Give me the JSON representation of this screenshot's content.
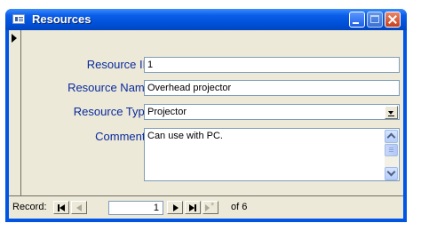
{
  "window": {
    "title": "Resources",
    "app_icon": "form-icon",
    "controls": [
      "minimize-icon",
      "maximize-icon",
      "close-icon"
    ]
  },
  "form": {
    "fields": [
      {
        "label": "Resource ID",
        "value": "1"
      },
      {
        "label": "Resource Name",
        "value": "Overhead projector"
      },
      {
        "label": "Resource Type",
        "value": "Projector"
      },
      {
        "label": "Comments",
        "value": "Can use with PC."
      }
    ]
  },
  "navigation": {
    "label": "Record:",
    "current_record": "1",
    "of_text": "of 6",
    "buttons": [
      "first-record-icon",
      "previous-record-icon",
      "next-record-icon",
      "last-record-icon",
      "new-record-icon"
    ]
  },
  "colors": {
    "titlebar": "#0055e5",
    "label_text": "#0a2a9e",
    "form_background": "#ece9d8"
  }
}
